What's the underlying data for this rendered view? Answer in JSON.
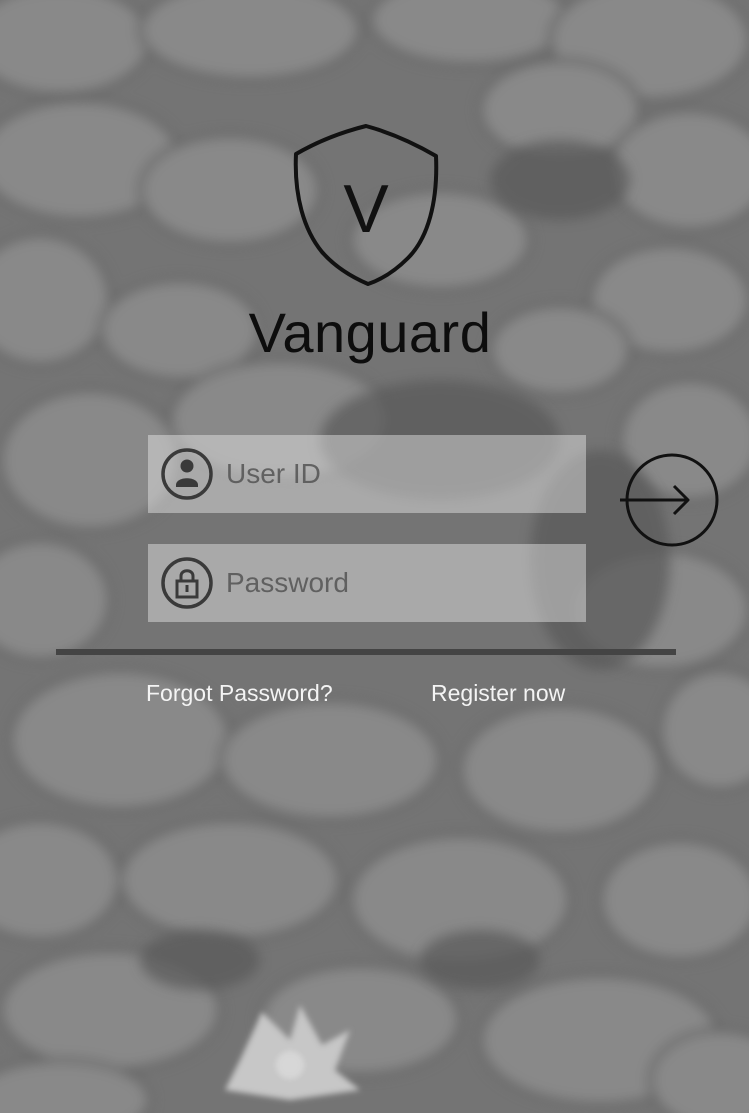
{
  "app": {
    "title": "Vanguard",
    "logo_letter": "V",
    "logo_icon": "shield-icon"
  },
  "login": {
    "user_id_placeholder": "User ID",
    "user_id_value": "",
    "user_icon": "user-icon",
    "password_placeholder": "Password",
    "password_value": "",
    "password_icon": "lock-icon",
    "submit_icon": "arrow-right-circle-icon"
  },
  "links": {
    "forgot_password": "Forgot Password?",
    "register": "Register now"
  },
  "colors": {
    "background": "#7d7d7d",
    "text_dark": "#0d0d0d",
    "link_text": "#f4f4f4",
    "field_bg": "rgba(235,235,235,0.45)",
    "divider": "#444444"
  }
}
